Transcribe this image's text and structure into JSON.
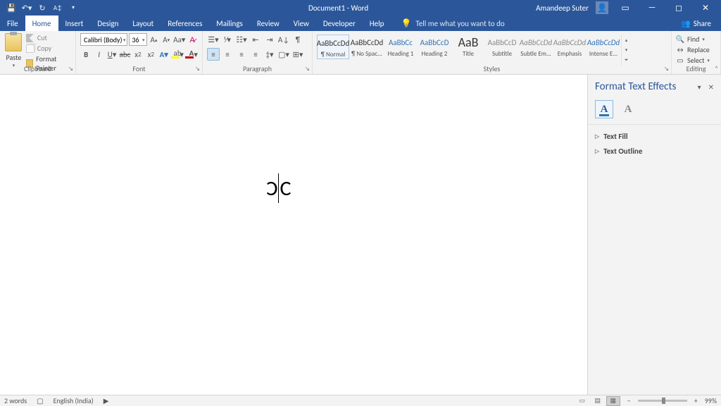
{
  "titlebar": {
    "doc_title": "Document1 - Word",
    "user_name": "Amandeep Suter"
  },
  "tabs": {
    "file": "File",
    "home": "Home",
    "insert": "Insert",
    "design": "Design",
    "layout": "Layout",
    "references": "References",
    "mailings": "Mailings",
    "review": "Review",
    "view": "View",
    "developer": "Developer",
    "help": "Help",
    "tell_me": "Tell me what you want to do",
    "share": "Share"
  },
  "ribbon": {
    "clipboard": {
      "label": "Clipboard",
      "paste": "Paste",
      "cut": "Cut",
      "copy": "Copy",
      "painter": "Format Painter"
    },
    "font": {
      "label": "Font",
      "name": "Calibri (Body)",
      "size": "36"
    },
    "paragraph": {
      "label": "Paragraph"
    },
    "styles": {
      "label": "Styles",
      "items": [
        {
          "preview": "AaBbCcDd",
          "name": "¶ Normal",
          "cls": ""
        },
        {
          "preview": "AaBbCcDd",
          "name": "¶ No Spac...",
          "cls": ""
        },
        {
          "preview": "AaBbCc",
          "name": "Heading 1",
          "cls": "blue"
        },
        {
          "preview": "AaBbCcD",
          "name": "Heading 2",
          "cls": "blue"
        },
        {
          "preview": "AaB",
          "name": "Title",
          "cls": "big"
        },
        {
          "preview": "AaBbCcD",
          "name": "Subtitle",
          "cls": "gray"
        },
        {
          "preview": "AaBbCcDd",
          "name": "Subtle Em...",
          "cls": "em"
        },
        {
          "preview": "AaBbCcDd",
          "name": "Emphasis",
          "cls": "em"
        },
        {
          "preview": "AaBbCcDd",
          "name": "Intense E...",
          "cls": "ie"
        }
      ]
    },
    "editing": {
      "label": "Editing",
      "find": "Find",
      "replace": "Replace",
      "select": "Select"
    }
  },
  "pane": {
    "title": "Format Text Effects",
    "sect_fill": "Text Fill",
    "sect_outline": "Text Outline"
  },
  "document": {
    "text_left": "Ɔ",
    "text_right": "C"
  },
  "status": {
    "words": "2 words",
    "language": "English (India)",
    "zoom": "99%"
  }
}
